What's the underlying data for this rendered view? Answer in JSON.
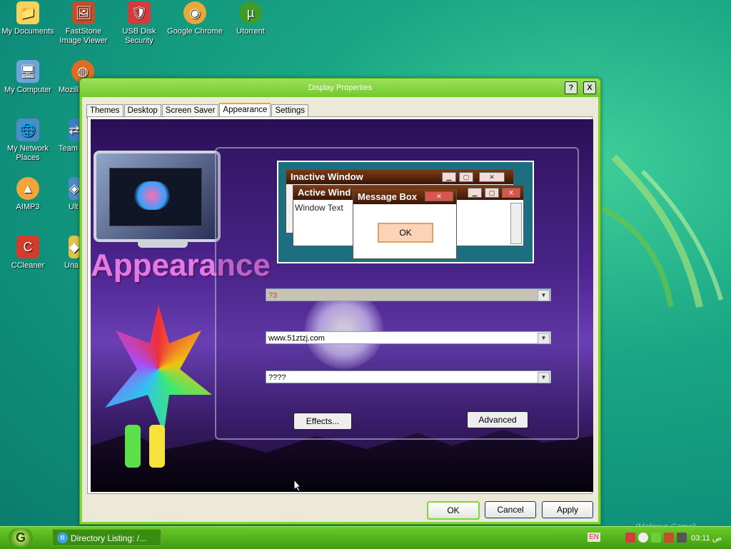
{
  "desktop": {
    "icons": [
      {
        "label": "My Documents",
        "glyph": "📁",
        "bg": "#f7d35b"
      },
      {
        "label": "FastStone Image Viewer",
        "glyph": "🖼",
        "bg": "#c44e2b"
      },
      {
        "label": "USB Disk Security",
        "glyph": "🛡",
        "bg": "#d63b3b"
      },
      {
        "label": "Google Chrome",
        "glyph": "◉",
        "bg": "#e7a93a"
      },
      {
        "label": "Utorrent",
        "glyph": "µ",
        "bg": "#3f9b2c"
      },
      {
        "label": "My Computer",
        "glyph": "🖥",
        "bg": "#6fa5d6"
      },
      {
        "label": "Mozill",
        "glyph": "◍",
        "bg": "#e06c23"
      },
      {
        "label": "My Network Places",
        "glyph": "🌐",
        "bg": "#4f8bc4"
      },
      {
        "label": "Team",
        "glyph": "⇄",
        "bg": "#3f7ec2"
      },
      {
        "label": "AIMP3",
        "glyph": "▲",
        "bg": "#f2a53a"
      },
      {
        "label": "Ult",
        "glyph": "◈",
        "bg": "#4f88c9"
      },
      {
        "label": "CCleaner",
        "glyph": "C",
        "bg": "#d33b2b"
      },
      {
        "label": "Una",
        "glyph": "◆",
        "bg": "#e5c34a"
      }
    ]
  },
  "window": {
    "title": "Display Properties",
    "help_label": "?",
    "close_label": "X",
    "tabs": [
      "Themes",
      "Desktop",
      "Screen Saver",
      "Appearance",
      "Settings"
    ],
    "active_tab": "Appearance",
    "preview": {
      "inactive_title": "Inactive Window",
      "active_title": "Active Wind",
      "message_title": "Message Box",
      "window_text": "Window Text",
      "ok_label": "OK"
    },
    "banner_text": "Appearance",
    "dropdowns": [
      {
        "value": "?3"
      },
      {
        "value": "www.51ztzj.com"
      },
      {
        "value": "????"
      }
    ],
    "effects_label": "Effects...",
    "advanced_label": "Advanced",
    "footer": {
      "ok": "OK",
      "cancel": "Cancel",
      "apply": "Apply"
    }
  },
  "taskbar": {
    "task_label": "Directory Listing: /...",
    "lang": "EN",
    "clock": "03:11 ص",
    "watermark": "(Mahrous Gamal)"
  },
  "colors": {
    "accent": "#7fd63a",
    "taskbar": "#4fa517",
    "dialog": "#ece9d8"
  }
}
